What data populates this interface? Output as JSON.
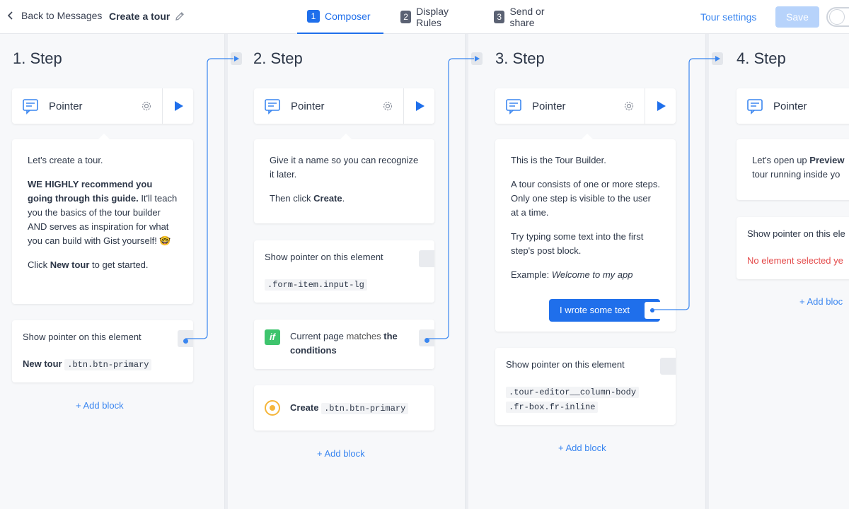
{
  "topbar": {
    "back_label": "Back to Messages",
    "title": "Create a tour",
    "tabs": [
      {
        "num": "1",
        "label": "Composer",
        "active": true
      },
      {
        "num": "2",
        "label": "Display Rules",
        "active": false
      },
      {
        "num": "3",
        "label": "Send or share",
        "active": false
      }
    ],
    "tour_settings": "Tour settings",
    "save": "Save"
  },
  "steps": [
    {
      "title": "1. Step",
      "pointer_label": "Pointer",
      "bubble": {
        "p1": "Let's create a tour.",
        "p2_bold": "WE HIGHLY recommend you going through this guide.",
        "p2_rest": " It'll teach you the basics of the tour builder AND serves as inspiration for what you can build with Gist yourself! 🤓",
        "p3_pre": "Click ",
        "p3_bold": "New tour",
        "p3_post": " to get started."
      },
      "block": {
        "label": "Show pointer on this element",
        "bold": "New tour",
        "selector": ".btn.btn-primary"
      },
      "add_block": "+ Add block"
    },
    {
      "title": "2. Step",
      "pointer_label": "Pointer",
      "bubble": {
        "p1": "Give it a name so you can recognize it later.",
        "p2_pre": "Then click ",
        "p2_bold": "Create",
        "p2_post": "."
      },
      "block": {
        "label": "Show pointer on this element",
        "selector": ".form-item.input-lg"
      },
      "condition": {
        "icon_text": "if",
        "pre": "Current page ",
        "mid": "matches",
        "bold1": " the",
        "bold2": "conditions"
      },
      "create_block": {
        "bold": "Create",
        "selector": ".btn.btn-primary"
      },
      "add_block": "+ Add block"
    },
    {
      "title": "3. Step",
      "pointer_label": "Pointer",
      "bubble": {
        "p1": "This is the Tour Builder.",
        "p2": "A tour consists of one or more steps. Only one step is visible to the user at a time.",
        "p3": "Try typing some text into the first step's post block.",
        "p4_pre": "Example: ",
        "p4_italic": "Welcome to my app",
        "button": "I wrote some text"
      },
      "block": {
        "label": "Show pointer on this element",
        "selector1": ".tour-editor__column-body",
        "selector2": ".fr-box.fr-inline"
      },
      "add_block": "+ Add block"
    },
    {
      "title": "4. Step",
      "pointer_label": "Pointer",
      "bubble": {
        "p1_pre": "Let's open up ",
        "p1_bold": "Preview",
        "p2": "tour running inside yo"
      },
      "block": {
        "label": "Show pointer on this ele",
        "error": "No element selected ye"
      },
      "add_block": "+ Add bloc"
    }
  ],
  "colors": {
    "accent": "#1f6feb",
    "link": "#3a86f0",
    "error": "#e44b4b",
    "condition_green": "#3ec46d",
    "target_yellow": "#f5b63b"
  }
}
